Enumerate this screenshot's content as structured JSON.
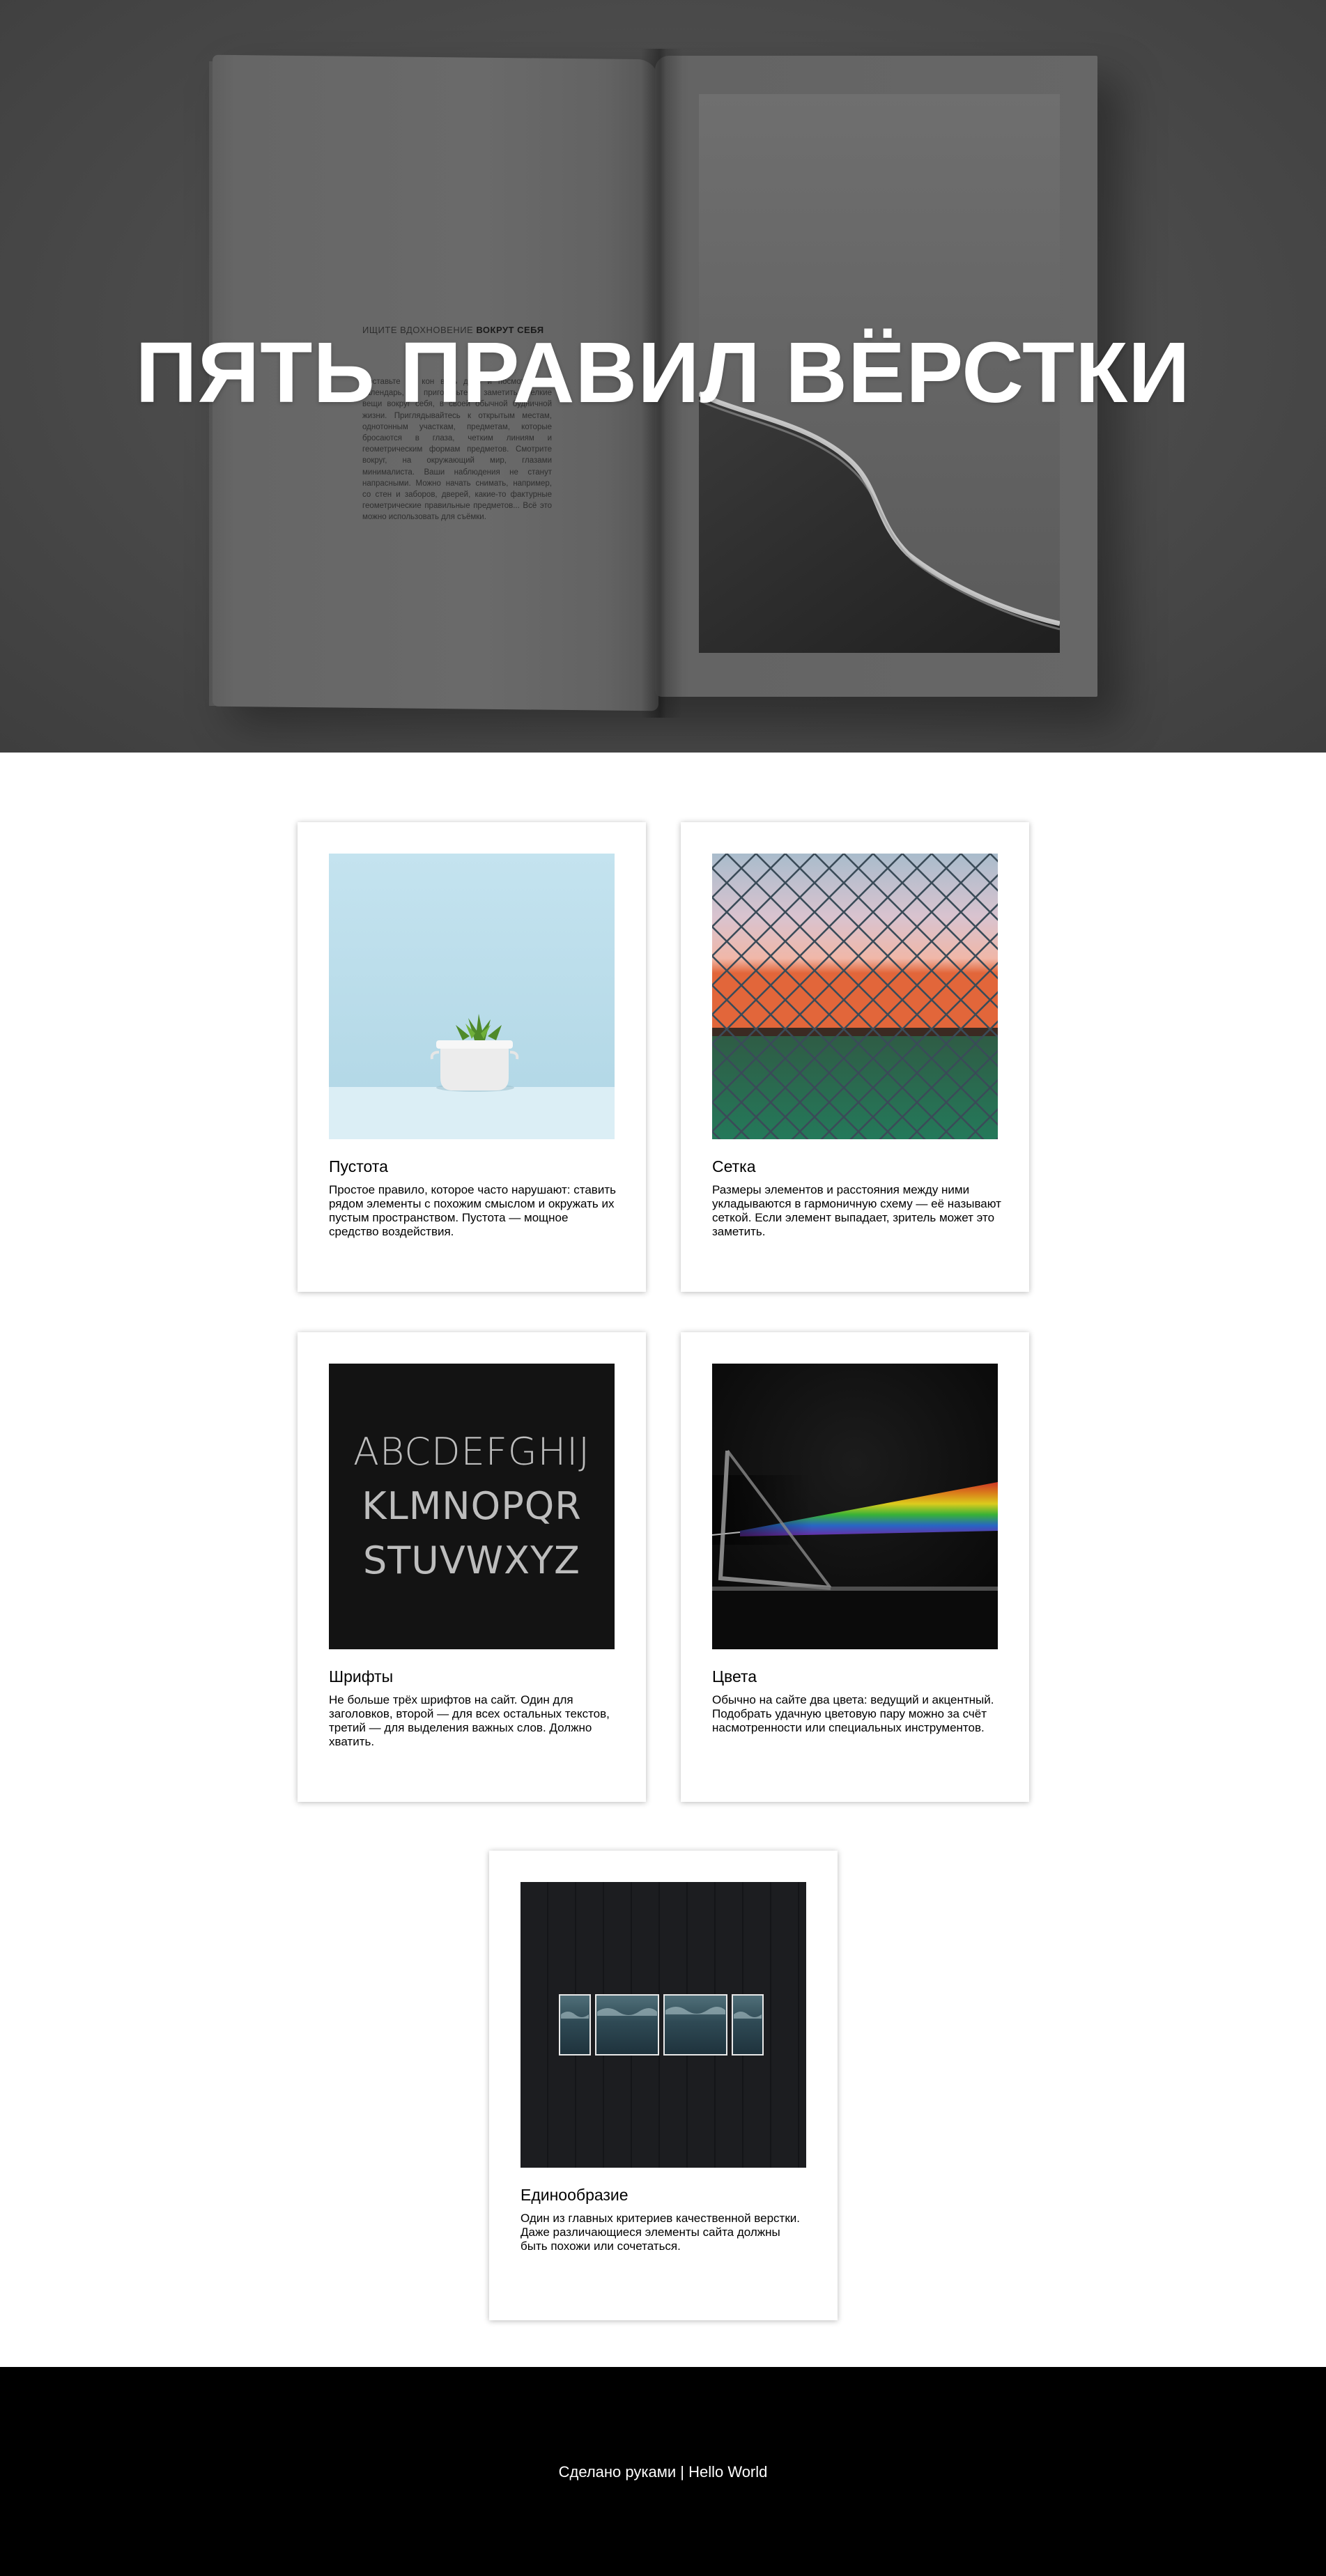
{
  "hero": {
    "title": "ПЯТЬ ПРАВИЛ ВЁРСТКИ",
    "magazine_heading_light": "ИЩИТЕ ВДОХНОВЕНИЕ",
    "magazine_heading_bold": "ВОКРУТ СЕБЯ",
    "magazine_body": "Поставьте на кон весь день и посмотрите в календарь, и приготовьтесь заметить мелкие вещи вокруг себя, в своей обычной будничной жизни. Приглядывайтесь к открытым местам, однотонным участкам, предметам, которые бросаются в глаза, четким линиям и геометрическим формам предметов. Смотрите вокруг, на окружающий мир, глазами минималиста. Ваши наблюдения не станут напрасными. Можно начать снимать, например, со стен и заборов, дверей, какие-то фактурные геометрические правильные предметов... Всё это можно использовать для съёмки."
  },
  "cards": [
    {
      "title": "Пустота",
      "text": "Простое правило, которое часто нарушают: ставить рядом элементы с похожим смыслом и окружать их пустым пространством. Пустота — мощное средство воздействия."
    },
    {
      "title": "Сетка",
      "text": "Размеры элементов и расстояния между ними укладываются в гармоничную схему — её называют сеткой. Если элемент выпадает, зритель может это заметить."
    },
    {
      "title": "Шрифты",
      "text": "Не больше трёх шрифтов на сайт. Один для заголовков, второй — для всех остальных текстов, третий — для выделения важных слов. Должно хватить.",
      "image_text": [
        "ABCDEFGHIJ",
        "KLMNOPQR",
        "STUVWXYZ"
      ]
    },
    {
      "title": "Цвета",
      "text": "Обычно на сайте два цвета: ведущий и акцентный. Подобрать удачную цветовую пару можно за счёт насмотренности или специальных инструментов."
    },
    {
      "title": "Единообразие",
      "text": "Один из главных критериев качественной верстки. Даже различающиеся элементы сайта должны быть похожи или сочетаться."
    }
  ],
  "footer": {
    "text": "Сделано руками | Hello World"
  }
}
